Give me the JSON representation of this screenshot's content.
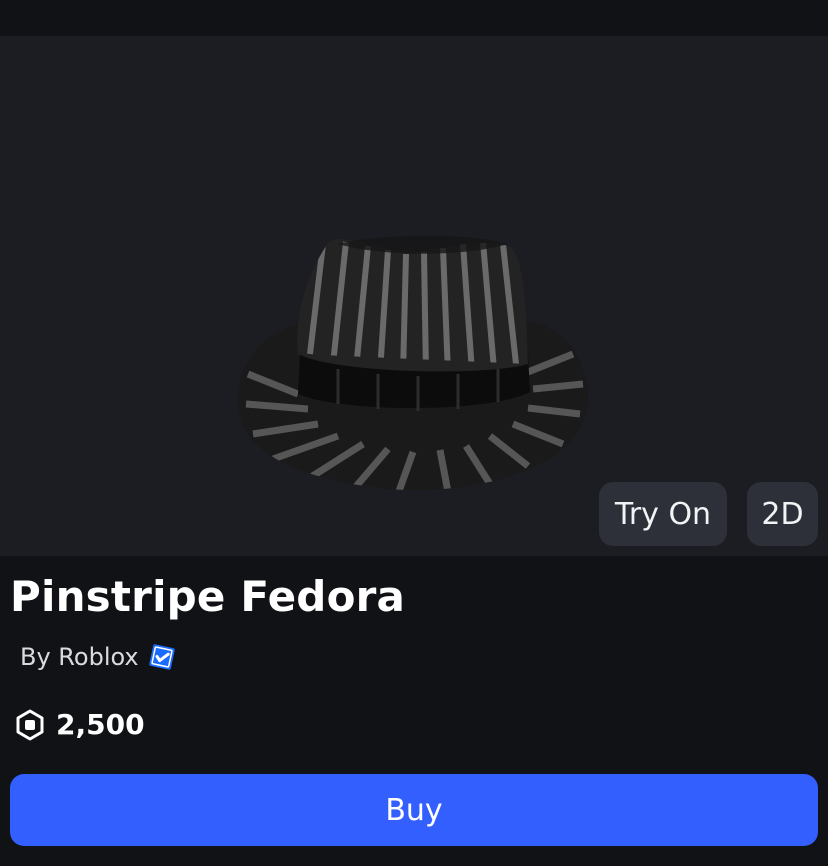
{
  "item": {
    "title": "Pinstripe Fedora",
    "creator_label": "By Roblox",
    "verified": true,
    "price": "2,500"
  },
  "preview": {
    "try_on_label": "Try On",
    "view_mode_label": "2D",
    "image_icon": "fedora-hat-image"
  },
  "actions": {
    "buy_label": "Buy"
  },
  "colors": {
    "background": "#111216",
    "preview_background": "#1b1d23",
    "button_secondary": "#2d3038",
    "accent": "#335fff",
    "verified": "#1c6bff"
  },
  "icons": {
    "verified": "verified-check-icon",
    "currency": "robux-icon"
  }
}
